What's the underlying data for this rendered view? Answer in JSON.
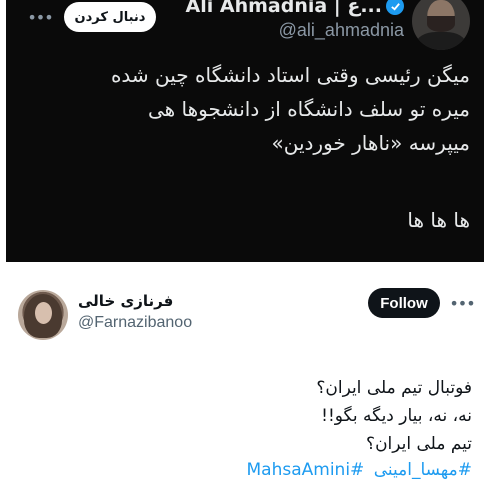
{
  "top_tweet": {
    "display_name": "Ali Ahmadnia | ع...",
    "handle": "@ali_ahmadnia",
    "follow_label": "دنبال کردن",
    "more_icon": "more-icon",
    "verified_icon": "verified-badge-icon",
    "lines": [
      "میگن رئیسی وقتی استاد دانشگاه چین شده",
      "میره تو سلف دانشگاه از دانشجوها هی",
      "میپرسه «ناهار خوردین»"
    ],
    "laugh": "ها ها ها",
    "colors": {
      "background": "#0a0a0a",
      "text": "#e7e9ea",
      "muted": "#8b98a5",
      "verified": "#1d9bf0"
    }
  },
  "bottom_tweet": {
    "display_name": "فرنازی خالی",
    "handle": "@Farnazibanoo",
    "follow_label": "Follow",
    "more_icon": "more-icon",
    "lines": [
      "فوتبال تیم ملی ایران؟",
      "نه، نه، بیار دیگه بگو!!",
      "تیم ملی ایران؟"
    ],
    "hashtags": [
      "#مهسا_امینی",
      "#MahsaAmini"
    ],
    "colors": {
      "background": "#ffffff",
      "text": "#0f1419",
      "muted": "#536471",
      "link": "#1d9bf0",
      "button": "#0f1419"
    }
  }
}
